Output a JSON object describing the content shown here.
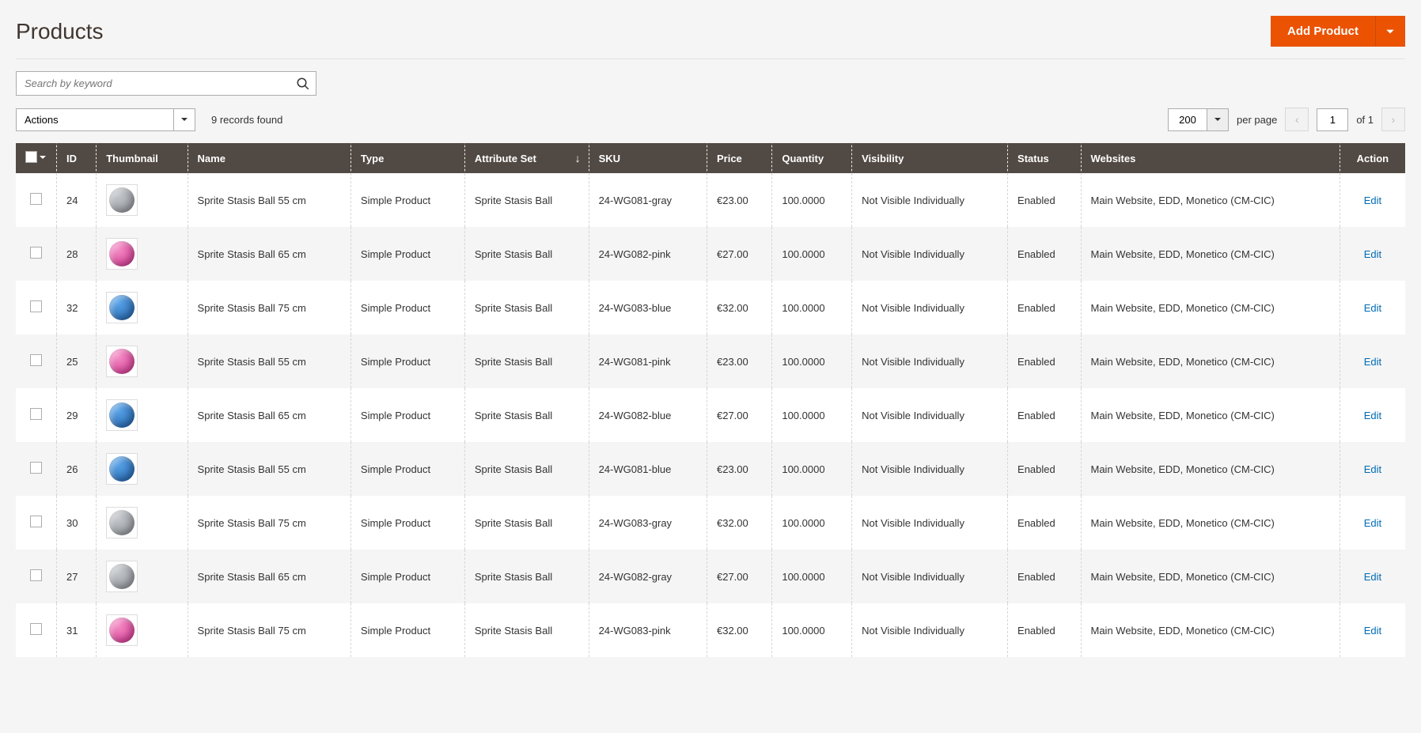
{
  "page": {
    "title": "Products",
    "add_button": "Add Product"
  },
  "search": {
    "placeholder": "Search by keyword"
  },
  "toolbar": {
    "actions_label": "Actions",
    "records_found": "9 records found",
    "per_page_value": "200",
    "per_page_label": "per page",
    "current_page": "1",
    "of_label": "of 1"
  },
  "columns": {
    "id": "ID",
    "thumbnail": "Thumbnail",
    "name": "Name",
    "type": "Type",
    "attribute_set": "Attribute Set",
    "sku": "SKU",
    "price": "Price",
    "quantity": "Quantity",
    "visibility": "Visibility",
    "status": "Status",
    "websites": "Websites",
    "action": "Action"
  },
  "rows": [
    {
      "id": "24",
      "name": "Sprite Stasis Ball 55 cm",
      "type": "Simple Product",
      "attribute_set": "Sprite Stasis Ball",
      "sku": "24-WG081-gray",
      "price": "€23.00",
      "quantity": "100.0000",
      "visibility": "Not Visible Individually",
      "status": "Enabled",
      "websites": "Main Website, EDD, Monetico (CM-CIC)",
      "action": "Edit",
      "color": "gray"
    },
    {
      "id": "28",
      "name": "Sprite Stasis Ball 65 cm",
      "type": "Simple Product",
      "attribute_set": "Sprite Stasis Ball",
      "sku": "24-WG082-pink",
      "price": "€27.00",
      "quantity": "100.0000",
      "visibility": "Not Visible Individually",
      "status": "Enabled",
      "websites": "Main Website, EDD, Monetico (CM-CIC)",
      "action": "Edit",
      "color": "pink"
    },
    {
      "id": "32",
      "name": "Sprite Stasis Ball 75 cm",
      "type": "Simple Product",
      "attribute_set": "Sprite Stasis Ball",
      "sku": "24-WG083-blue",
      "price": "€32.00",
      "quantity": "100.0000",
      "visibility": "Not Visible Individually",
      "status": "Enabled",
      "websites": "Main Website, EDD, Monetico (CM-CIC)",
      "action": "Edit",
      "color": "blue"
    },
    {
      "id": "25",
      "name": "Sprite Stasis Ball 55 cm",
      "type": "Simple Product",
      "attribute_set": "Sprite Stasis Ball",
      "sku": "24-WG081-pink",
      "price": "€23.00",
      "quantity": "100.0000",
      "visibility": "Not Visible Individually",
      "status": "Enabled",
      "websites": "Main Website, EDD, Monetico (CM-CIC)",
      "action": "Edit",
      "color": "pink"
    },
    {
      "id": "29",
      "name": "Sprite Stasis Ball 65 cm",
      "type": "Simple Product",
      "attribute_set": "Sprite Stasis Ball",
      "sku": "24-WG082-blue",
      "price": "€27.00",
      "quantity": "100.0000",
      "visibility": "Not Visible Individually",
      "status": "Enabled",
      "websites": "Main Website, EDD, Monetico (CM-CIC)",
      "action": "Edit",
      "color": "blue"
    },
    {
      "id": "26",
      "name": "Sprite Stasis Ball 55 cm",
      "type": "Simple Product",
      "attribute_set": "Sprite Stasis Ball",
      "sku": "24-WG081-blue",
      "price": "€23.00",
      "quantity": "100.0000",
      "visibility": "Not Visible Individually",
      "status": "Enabled",
      "websites": "Main Website, EDD, Monetico (CM-CIC)",
      "action": "Edit",
      "color": "blue"
    },
    {
      "id": "30",
      "name": "Sprite Stasis Ball 75 cm",
      "type": "Simple Product",
      "attribute_set": "Sprite Stasis Ball",
      "sku": "24-WG083-gray",
      "price": "€32.00",
      "quantity": "100.0000",
      "visibility": "Not Visible Individually",
      "status": "Enabled",
      "websites": "Main Website, EDD, Monetico (CM-CIC)",
      "action": "Edit",
      "color": "gray"
    },
    {
      "id": "27",
      "name": "Sprite Stasis Ball 65 cm",
      "type": "Simple Product",
      "attribute_set": "Sprite Stasis Ball",
      "sku": "24-WG082-gray",
      "price": "€27.00",
      "quantity": "100.0000",
      "visibility": "Not Visible Individually",
      "status": "Enabled",
      "websites": "Main Website, EDD, Monetico (CM-CIC)",
      "action": "Edit",
      "color": "gray"
    },
    {
      "id": "31",
      "name": "Sprite Stasis Ball 75 cm",
      "type": "Simple Product",
      "attribute_set": "Sprite Stasis Ball",
      "sku": "24-WG083-pink",
      "price": "€32.00",
      "quantity": "100.0000",
      "visibility": "Not Visible Individually",
      "status": "Enabled",
      "websites": "Main Website, EDD, Monetico (CM-CIC)",
      "action": "Edit",
      "color": "pink"
    }
  ]
}
